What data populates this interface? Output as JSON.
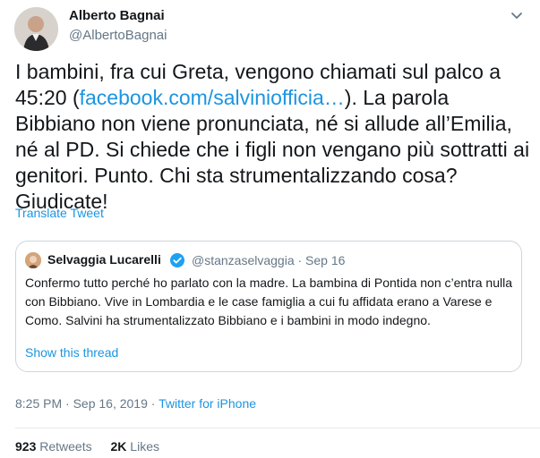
{
  "author": {
    "name": "Alberto Bagnai",
    "handle": "@AlbertoBagnai"
  },
  "tweet": {
    "text_before_link": "I bambini, fra cui Greta, vengono chiamati sul palco a 45:20 (",
    "link_text": "facebook.com/salviniofficia…",
    "text_after_link": "). La parola Bibbiano non viene pronunciata, né si allude all’Emilia, né al PD. Si chiede che i figli non vengano più sottratti ai genitori. Punto. Chi sta strumentalizzando cosa? Giudicate!",
    "translate_label": "Translate Tweet"
  },
  "quoted_tweet": {
    "name": "Selvaggia Lucarelli",
    "handle_date": "@stanzaselvaggia · Sep 16",
    "text": "Confermo tutto perché ho parlato con la madre. La bambina di Pontida non c’entra nulla con Bibbiano. Vive in Lombardia e le case famiglia a cui fu affidata erano a Varese e Como. Salvini ha strumentalizzato Bibbiano e i bambini in modo indegno.",
    "thread_label": "Show this thread"
  },
  "meta": {
    "timestamp": "8:25 PM · Sep 16, 2019 · ",
    "source": "Twitter for iPhone"
  },
  "stats": {
    "retweets_count": "923",
    "retweets_label": "Retweets",
    "likes_count": "2K",
    "likes_label": "Likes"
  },
  "colors": {
    "link": "#1b95e0",
    "secondary_text": "#657786",
    "border": "#ccd6dd"
  }
}
